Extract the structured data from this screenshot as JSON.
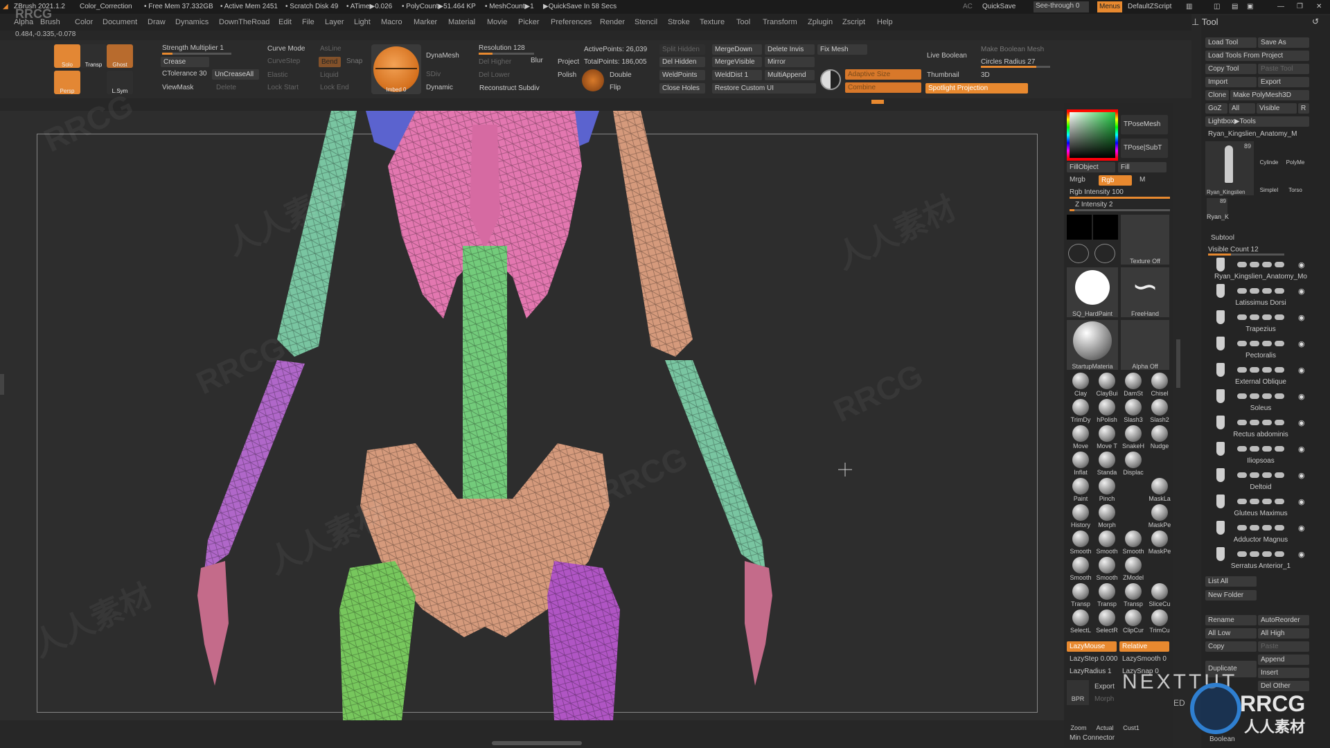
{
  "titlebar": {
    "app": "ZBrush 2021.1.2",
    "doc": "Color_Correction",
    "free_mem": "• Free Mem 37.332GB",
    "active_mem": "• Active Mem 2451",
    "scratch": "• Scratch Disk 49",
    "atime": "• ATime▶0.026",
    "polycount": "• PolyCount▶51.464 KP",
    "meshcount": "• MeshCount▶1",
    "quicksave_in": "▶QuickSave In 58 Secs",
    "ac": "AC",
    "quicksave": "QuickSave",
    "seethrough": "See-through",
    "seethrough_val": "0",
    "menus": "Menus",
    "script": "DefaultZScript"
  },
  "menubar": [
    "Alpha",
    "Brush",
    "Color",
    "Document",
    "Draw",
    "Dynamics",
    "DownTheRoad",
    "Edit",
    "File",
    "Layer",
    "Light",
    "Macro",
    "Marker",
    "Material",
    "Movie",
    "Picker",
    "Preferences",
    "Render",
    "Stencil",
    "Stroke",
    "Texture",
    "Tool",
    "Transform",
    "Zplugin",
    "Zscript",
    "Help"
  ],
  "coords": "0.484,-0.335,-0.078",
  "shelf": {
    "solo": "Solo",
    "transp": "Transp",
    "ghost": "Ghost",
    "persp": "Persp",
    "lsym": "L.Sym",
    "strength_mult": "Strength Multiplier 1",
    "crease": "Crease",
    "ctolerance": "CTolerance 30",
    "uncreaseall": "UnCreaseAll",
    "viewmask": "ViewMask",
    "delete": "Delete",
    "curve_mode": "Curve Mode",
    "asline": "AsLine",
    "curvestep": "CurveStep",
    "bend": "Bend",
    "snap": "Snap",
    "elastic": "Elastic",
    "liquid": "Liquid",
    "lock_start": "Lock Start",
    "lock_end": "Lock End",
    "imbed": "Imbed 0",
    "dynamesh": "DynaMesh",
    "del_higher": "Del Higher",
    "sdiv": "SDiv",
    "del_lower": "Del Lower",
    "dynamic": "Dynamic",
    "resolution": "Resolution 128",
    "blur": "Blur",
    "project": "Project",
    "polish": "Polish",
    "reconstruct": "Reconstruct Subdiv",
    "active_points": "ActivePoints: 26,039",
    "total_points": "TotalPoints: 186,005",
    "double": "Double",
    "flip": "Flip",
    "split_hidden": "Split Hidden",
    "del_hidden": "Del Hidden",
    "weld_points": "WeldPoints",
    "close_holes": "Close Holes",
    "merge_down": "MergeDown",
    "merge_visible": "MergeVisible",
    "weld_dist": "WeldDist 1",
    "restore_custom": "Restore Custom UI",
    "delete_invis": "Delete Invis",
    "mirror": "Mirror",
    "multiappend": "MultiAppend",
    "fix_mesh": "Fix Mesh",
    "adaptive_size": "Adaptive Size",
    "combine": "Combine",
    "live_boolean": "Live Boolean",
    "thumbnail": "Thumbnail",
    "three_d": "3D",
    "make_boolean": "Make Boolean Mesh",
    "circles_radius": "Circles Radius 27",
    "spotlight": "Spotlight Projection"
  },
  "brushpanel": {
    "tposemesh": "TPoseMesh",
    "tposesubt": "TPose|SubT",
    "fillobject": "FillObject",
    "fill": "Fill",
    "mrgb": "Mrgb",
    "rgb": "Rgb",
    "m": "M",
    "rgb_intensity": "Rgb Intensity 100",
    "z_intensity": "Z Intensity 2",
    "texture_off": "Texture Off",
    "sq_hardpaint": "SQ_HardPaint",
    "freehand": "FreeHand",
    "startup_material": "StartupMateria",
    "alpha_off": "Alpha Off",
    "brushes": [
      "Clay",
      "ClayBui",
      "DamSt",
      "Chisel",
      "TrimDy",
      "hPolish",
      "Slash3",
      "Slash2",
      "Move",
      "Move T",
      "SnakeH",
      "Nudge",
      "Inflat",
      "Standa",
      "Displac",
      "",
      "Paint",
      "Pinch",
      "",
      "MaskLa",
      "History",
      "Morph",
      "",
      "MaskPe",
      "Smooth",
      "Smooth",
      "Smooth",
      "MaskPe",
      "Smooth",
      "Smooth",
      "ZModel",
      "",
      "Transp",
      "Transp",
      "Transp",
      "SliceCu",
      "SelectL",
      "SelectR",
      "ClipCur",
      "TrimCu"
    ],
    "lazymouse": "LazyMouse",
    "relative": "Relative",
    "lazystep": "LazyStep 0.000",
    "lazysmooth": "LazySmooth 0",
    "lazyradius": "LazyRadius 1",
    "lazysnap": "LazySnap 0",
    "bpr": "BPR",
    "export": "Export",
    "morph": "Morph",
    "zoom": "Zoom",
    "actual": "Actual",
    "cust1": "Cust1",
    "min_connector": "Min Connector"
  },
  "tool": {
    "title": "Tool",
    "load_tool": "Load Tool",
    "save_as": "Save As",
    "load_from_project": "Load Tools From Project",
    "copy_tool": "Copy Tool",
    "paste_tool": "Paste Tool",
    "import": "Import",
    "export": "Export",
    "clone": "Clone",
    "make_polymesh": "Make PolyMesh3D",
    "goz": "GoZ",
    "all": "All",
    "visible": "Visible",
    "r": "R",
    "lightbox_tools": "Lightbox▶Tools",
    "current": "Ryan_Kingslien_Anatomy_M",
    "thumb_count": "89",
    "thumb_name": "Ryan_Kingslien",
    "cylinder": "Cylinde",
    "polymesh": "PolyMe",
    "simplebrush": "SimpleI",
    "torso": "Torso",
    "small_count": "89",
    "small_name": "Ryan_K",
    "subtool": "Subtool",
    "visible_count": "Visible Count 12",
    "subtools": [
      "Ryan_Kingslien_Anatomy_Mo",
      "Latissimus Dorsi",
      "Trapezius",
      "Pectoralis",
      "External Oblique",
      "Soleus",
      "Rectus abdominis",
      "Iliopsoas",
      "Deltoid",
      "Gluteus Maximus",
      "Adductor Magnus",
      "Serratus Anterior_1"
    ],
    "list_all": "List All",
    "new_folder": "New Folder",
    "rename": "Rename",
    "autoreorder": "AutoReorder",
    "all_low": "All Low",
    "all_high": "All High",
    "copy": "Copy",
    "paste": "Paste",
    "duplicate": "Duplicate",
    "append": "Append",
    "insert": "Insert",
    "del_other": "Del Other",
    "boolean": "Boolean"
  },
  "watermark": {
    "rrcg": "RRCG",
    "cn": "人人素材",
    "nexttut": "NEXTTUT",
    "nexttut_sub": "ED",
    "badge_rrcg": "RRCG",
    "badge_cn": "人人素材"
  },
  "colors": {
    "accent": "#e8892f",
    "ribs": "#e377b0",
    "spine": "#73cb7b",
    "pelvis": "#d59a7c",
    "humerus_left": "#79c5a1",
    "forearm_left": "#b067c9",
    "femur_left": "#77c75d",
    "femur_right": "#b055c4",
    "shoulder": "#5b63cf"
  }
}
